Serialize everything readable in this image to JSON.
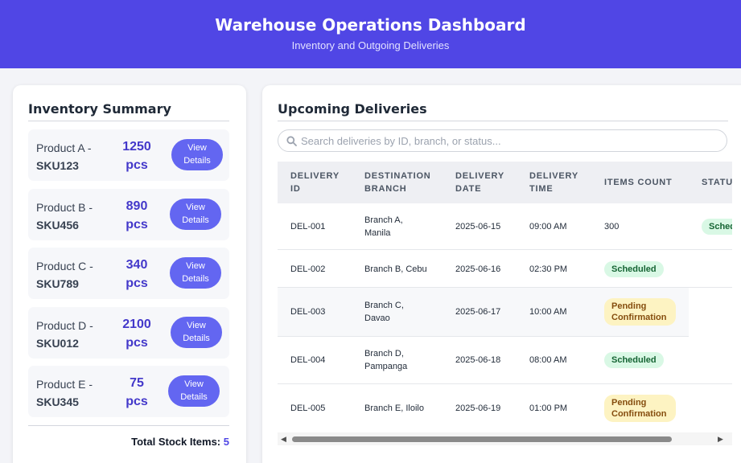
{
  "header": {
    "title": "Warehouse Operations Dashboard",
    "subtitle": "Inventory and Outgoing Deliveries"
  },
  "inventory": {
    "title": "Inventory Summary",
    "items": [
      {
        "name": "Product A -",
        "sku": "SKU123",
        "qty": "1250",
        "unit": "pcs",
        "button": "View\nDetails"
      },
      {
        "name": "Product B -",
        "sku": "SKU456",
        "qty": "890",
        "unit": "pcs",
        "button": "View\nDetails"
      },
      {
        "name": "Product C -",
        "sku": "SKU789",
        "qty": "340",
        "unit": "pcs",
        "button": "View\nDetails"
      },
      {
        "name": "Product D -",
        "sku": "SKU012",
        "qty": "2100",
        "unit": "pcs",
        "button": "View\nDetails"
      },
      {
        "name": "Product E -",
        "sku": "SKU345",
        "qty": "75",
        "unit": "pcs",
        "button": "View\nDetails"
      }
    ],
    "total_label": "Total Stock Items:",
    "total_value": "5"
  },
  "deliveries": {
    "title": "Upcoming Deliveries",
    "search_placeholder": "Search deliveries by ID, branch, or status...",
    "search_icon": "search-icon",
    "columns": [
      "Delivery ID",
      "Destination Branch",
      "Delivery Date",
      "Delivery Time",
      "Items Count",
      "Status"
    ],
    "rows": [
      {
        "id": "DEL-001",
        "branch": "Branch A, Manila",
        "date": "2025-06-15",
        "time": "09:00 AM",
        "items": "300",
        "status": "Scheduled"
      },
      {
        "id": "DEL-002",
        "branch": "Branch B, Cebu",
        "date": "2025-06-16",
        "time": "02:30 PM",
        "items": "",
        "status": "Scheduled"
      },
      {
        "id": "DEL-003",
        "branch": "Branch C, Davao",
        "date": "2025-06-17",
        "time": "10:00 AM",
        "items": "",
        "status": "Pending Confirmation"
      },
      {
        "id": "DEL-004",
        "branch": "Branch D, Pampanga",
        "date": "2025-06-18",
        "time": "08:00 AM",
        "items": "",
        "status": "Scheduled"
      },
      {
        "id": "DEL-005",
        "branch": "Branch E, Iloilo",
        "date": "2025-06-19",
        "time": "01:00 PM",
        "items": "",
        "status": "Pending Confirmation"
      }
    ]
  },
  "colors": {
    "header_bg": "#5046e5",
    "accent": "#6366f1",
    "qty_text": "#4338ca",
    "scheduled_bg": "#d9f8e5",
    "pending_bg": "#fdf3c2"
  }
}
